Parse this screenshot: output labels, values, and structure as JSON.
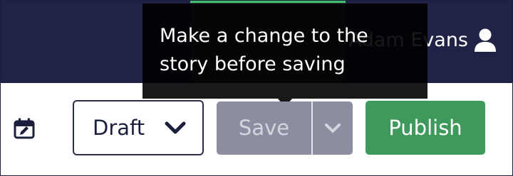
{
  "header": {
    "user_name": "Adam Evans",
    "user_icon": "user-icon",
    "background_color": "#212346"
  },
  "tooltip": {
    "text": "Make a change to the story before saving"
  },
  "toolbar": {
    "calendar_icon": "calendar-icon",
    "status_select": {
      "value": "Draft",
      "icon": "chevron-down-icon"
    },
    "save_button": {
      "label": "Save",
      "disabled": true,
      "dropdown_icon": "chevron-down-icon"
    },
    "publish_button": {
      "label": "Publish",
      "color": "#3d9a5c"
    }
  }
}
